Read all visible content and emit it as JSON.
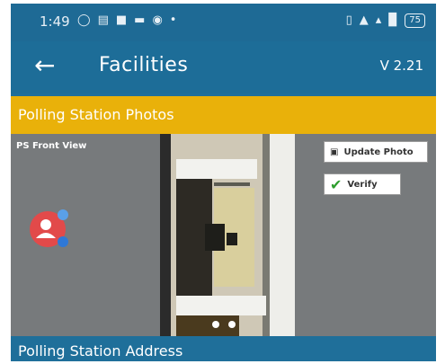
{
  "status_bar": {
    "time": "1:49",
    "battery": "75"
  },
  "app_bar": {
    "title": "Facilities",
    "version": "V 2.21"
  },
  "photos_section": {
    "header": "Polling Station Photos",
    "caption": "PS Front View",
    "update_button": "Update Photo",
    "verify_button": "Verify"
  },
  "address_section": {
    "header": "Polling Station Address"
  },
  "colors": {
    "primary": "#1d6d98",
    "accent": "#e9b10a",
    "verify_check": "#2e9e2e",
    "avatar": "#e24a4a"
  },
  "icons": {
    "back": "arrow-left-icon",
    "update": "photo-icon",
    "verify": "checkmark-icon",
    "avatar": "user-group-icon"
  }
}
